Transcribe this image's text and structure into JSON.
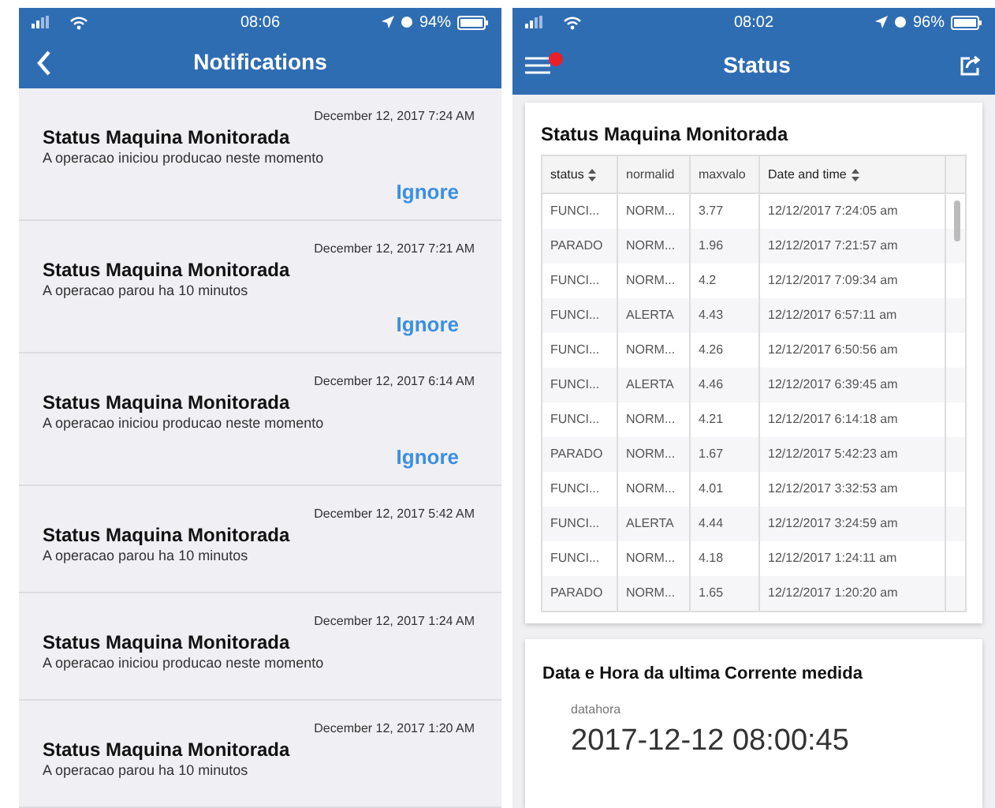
{
  "left_screen": {
    "status_bar": {
      "time": "08:06",
      "battery": "94%"
    },
    "title": "Notifications",
    "notifications": [
      {
        "date": "December 12, 2017 7:24 AM",
        "title": "Status Maquina Monitorada",
        "message": "A operacao iniciou producao neste momento",
        "action": "Ignore"
      },
      {
        "date": "December 12, 2017 7:21 AM",
        "title": "Status Maquina Monitorada",
        "message": "A operacao parou ha 10 minutos",
        "action": "Ignore"
      },
      {
        "date": "December 12, 2017 6:14 AM",
        "title": "Status Maquina Monitorada",
        "message": "A operacao iniciou producao neste momento",
        "action": "Ignore"
      },
      {
        "date": "December 12, 2017 5:42 AM",
        "title": "Status Maquina Monitorada",
        "message": "A operacao parou ha 10 minutos"
      },
      {
        "date": "December 12, 2017 1:24 AM",
        "title": "Status Maquina Monitorada",
        "message": "A operacao iniciou producao neste momento"
      },
      {
        "date": "December 12, 2017 1:20 AM",
        "title": "Status Maquina Monitorada",
        "message": "A operacao parou ha 10 minutos"
      }
    ]
  },
  "right_screen": {
    "status_bar": {
      "time": "08:02",
      "battery": "96%"
    },
    "title": "Status",
    "menu_notification_dot": true,
    "table_card": {
      "title": "Status Maquina Monitorada",
      "columns": [
        {
          "label": "status",
          "sortable": true
        },
        {
          "label": "normalid",
          "sortable": false
        },
        {
          "label": "maxvalo",
          "sortable": false
        },
        {
          "label": "Date and time",
          "sortable": true
        }
      ],
      "rows": [
        [
          "FUNCI...",
          "NORM...",
          "3.77",
          "12/12/2017 7:24:05 am"
        ],
        [
          "PARADO",
          "NORM...",
          "1.96",
          "12/12/2017 7:21:57 am"
        ],
        [
          "FUNCI...",
          "NORM...",
          "4.2",
          "12/12/2017 7:09:34 am"
        ],
        [
          "FUNCI...",
          "ALERTA",
          "4.43",
          "12/12/2017 6:57:11 am"
        ],
        [
          "FUNCI...",
          "NORM...",
          "4.26",
          "12/12/2017 6:50:56 am"
        ],
        [
          "FUNCI...",
          "ALERTA",
          "4.46",
          "12/12/2017 6:39:45 am"
        ],
        [
          "FUNCI...",
          "NORM...",
          "4.21",
          "12/12/2017 6:14:18 am"
        ],
        [
          "PARADO",
          "NORM...",
          "1.67",
          "12/12/2017 5:42:23 am"
        ],
        [
          "FUNCI...",
          "NORM...",
          "4.01",
          "12/12/2017 3:32:53 am"
        ],
        [
          "FUNCI...",
          "ALERTA",
          "4.44",
          "12/12/2017 3:24:59 am"
        ],
        [
          "FUNCI...",
          "NORM...",
          "4.18",
          "12/12/2017 1:24:11 am"
        ],
        [
          "PARADO",
          "NORM...",
          "1.65",
          "12/12/2017 1:20:20 am"
        ]
      ]
    },
    "last_reading_card": {
      "title": "Data e Hora da ultima Corrente medida",
      "label": "datahora",
      "value": "2017-12-12 08:00:45"
    }
  }
}
